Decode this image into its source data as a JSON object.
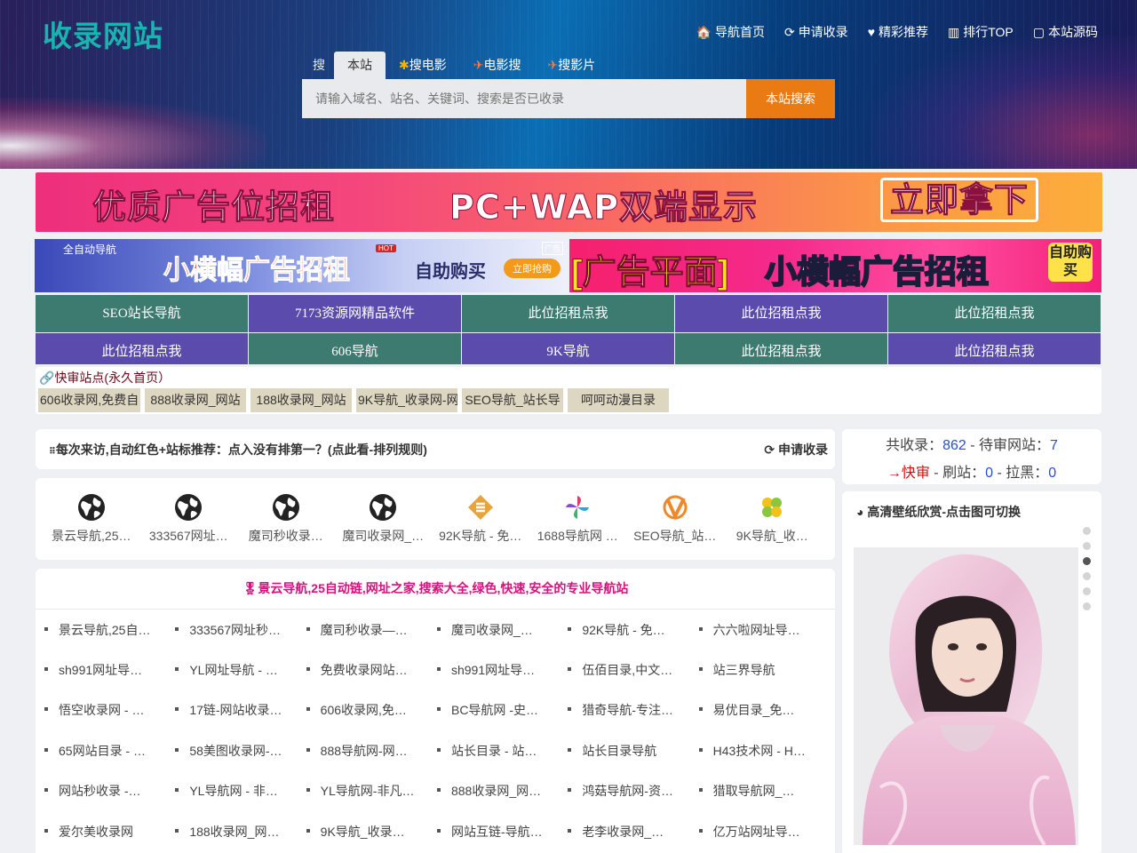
{
  "site": {
    "logo": "收录网站"
  },
  "nav": [
    {
      "icon": "home-icon",
      "glyph": "🏠",
      "label": "导航首页"
    },
    {
      "icon": "refresh-icon",
      "glyph": "⟳",
      "label": "申请收录"
    },
    {
      "icon": "heart-icon",
      "glyph": "♥",
      "label": "精彩推荐"
    },
    {
      "icon": "bar-chart-icon",
      "glyph": "▥",
      "label": "排行TOP"
    },
    {
      "icon": "code-icon",
      "glyph": "▢",
      "label": "本站源码"
    }
  ],
  "search": {
    "label": "搜",
    "tabs": [
      {
        "label": "本站",
        "active": true
      },
      {
        "label": "搜电影",
        "icon": "star-icon"
      },
      {
        "label": "电影搜",
        "icon": "plane-icon"
      },
      {
        "label": "搜影片",
        "icon": "plane-icon"
      }
    ],
    "placeholder": "请输入域名、站名、关键词、搜索是否已收录",
    "button": "本站搜索"
  },
  "banners": {
    "top": [
      "优质广告位招租",
      "PC+WAP双端显示",
      "立即拿下"
    ],
    "left": {
      "tag": "全自动导航",
      "title": "小横幅广告招租",
      "hot": "HOT",
      "ad": "广告",
      "buy": "自助购买",
      "btn": "立即抢购"
    },
    "right": {
      "title": "[广告平面]",
      "title2": "小横幅广告招租",
      "buy": "自助购买"
    }
  },
  "grid_links": [
    {
      "label": "SEO站长导航",
      "color": "teal"
    },
    {
      "label": "7173资源网精品软件",
      "color": "purple"
    },
    {
      "label": "此位招租点我",
      "color": "teal"
    },
    {
      "label": "此位招租点我",
      "color": "purple"
    },
    {
      "label": "此位招租点我",
      "color": "teal"
    },
    {
      "label": "此位招租点我",
      "color": "purple"
    },
    {
      "label": "606导航",
      "color": "teal"
    },
    {
      "label": "9K导航",
      "color": "purple"
    },
    {
      "label": "此位招租点我",
      "color": "teal"
    },
    {
      "label": "此位招租点我",
      "color": "purple"
    }
  ],
  "quick": {
    "title": "快审站点(永久首页）",
    "items": [
      "606收录网,免费自",
      "888收录网_网站",
      "188收录网_网站",
      "9K导航_收录网-网",
      "SEO导航_站长导",
      "呵呵动漫目录"
    ]
  },
  "rule": {
    "text": "每次来访,自动红色+站标推荐：点入没有排第一？(点此看-排列规则)",
    "apply": "申请收录"
  },
  "featured": [
    {
      "label": "景云导航,25…",
      "icon": "globe-icon"
    },
    {
      "label": "333567网址…",
      "icon": "globe-icon"
    },
    {
      "label": "魔司秒收录…",
      "icon": "globe-icon"
    },
    {
      "label": "魔司收录网_…",
      "icon": "globe-icon"
    },
    {
      "label": "92K导航 - 免…",
      "icon": "s-logo-icon"
    },
    {
      "label": "1688导航网 …",
      "icon": "pinwheel-icon"
    },
    {
      "label": "SEO导航_站…",
      "icon": "v-logo-icon"
    },
    {
      "label": "9K导航_收…",
      "icon": "clover-icon"
    }
  ],
  "list": {
    "title": "景云导航,25自动链,网址之家,搜索大全,绿色,快速,安全的专业导航站",
    "rows": [
      [
        "景云导航,25自…",
        "333567网址秒…",
        "魔司秒收录—…",
        "魔司收录网_…",
        "92K导航 - 免…",
        "六六啦网址导…"
      ],
      [
        "sh991网址导…",
        "YL网址导航 - …",
        "免费收录网站…",
        "sh991网址导…",
        "伍佰目录,中文…",
        "站三界导航"
      ],
      [
        "悟空收录网 - …",
        "17链-网站收录…",
        "606收录网,免…",
        "BC导航网 -史…",
        "猎奇导航-专注…",
        "易优目录_免…"
      ],
      [
        "65网站目录 - …",
        "58美图收录网-…",
        "888导航网-网…",
        "站长目录 - 站…",
        "站长目录导航",
        "H43技术网 - H…"
      ],
      [
        "网站秒收录 -…",
        "YL导航网 - 非…",
        "YL导航网-非凡…",
        "888收录网_网…",
        "鸿菇导航网-资…",
        "猎取导航网_…"
      ],
      [
        "爱尔美收录网",
        "188收录网_网…",
        "9K导航_收录…",
        "网站互链-导航…",
        "老李收录网_…",
        "亿万站网址导…"
      ]
    ]
  },
  "stats": {
    "total_label": "共收录：",
    "total": "862",
    "pending_label": " - 待审网站：",
    "pending": "7",
    "fast": "→快审",
    "brush_label": " - 刷站：",
    "brush": "0",
    "black_label": " - 拉黑：",
    "black": "0"
  },
  "wallpaper": {
    "title": "高清壁纸欣赏-点击图可切换",
    "slides": 6,
    "active": 2
  }
}
